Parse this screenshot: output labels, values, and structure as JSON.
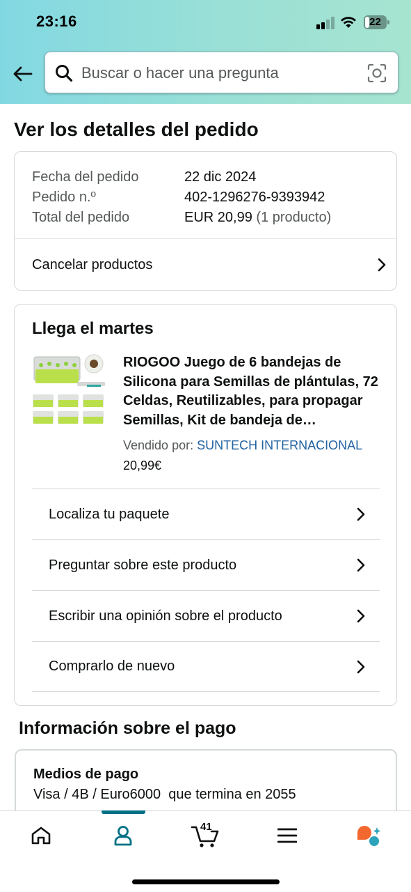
{
  "status_bar": {
    "time": "23:16",
    "battery": "22",
    "battery_level": 0.22
  },
  "header": {
    "back_icon": "arrow-left-icon",
    "search_placeholder": "Buscar o hacer una pregunta",
    "search_icon": "search-icon",
    "camera_icon": "camera-scan-icon"
  },
  "page": {
    "title": "Ver los detalles del pedido"
  },
  "order_summary": {
    "rows": [
      {
        "label": "Fecha del pedido",
        "value": "22 dic 2024",
        "extra": ""
      },
      {
        "label": "Pedido n.º",
        "value": "402-1296276-9393942",
        "extra": ""
      },
      {
        "label": "Total del pedido",
        "value": "EUR 20,99",
        "extra": "(1 producto)"
      }
    ],
    "cancel_label": "Cancelar productos"
  },
  "delivery": {
    "title": "Llega el martes",
    "product": {
      "title": "RIOGOO Juego de 6 bandejas de Silicona para Semillas de plántulas, 72 Celdas, Reutilizables, para propagar Semillas, Kit de bandeja de germinación",
      "seller_prefix": "Vendido por:",
      "seller_name": "SUNTECH INTERNACIONAL",
      "price": "20,99€"
    },
    "actions": [
      {
        "label": "Localiza tu paquete"
      },
      {
        "label": "Preguntar sobre este producto"
      },
      {
        "label": "Escribir una opinión sobre el producto"
      },
      {
        "label": "Comprarlo de nuevo"
      }
    ]
  },
  "payment": {
    "section_title": "Información sobre el pago",
    "method_label": "Medios de pago",
    "method_value": "Visa / 4B / Euro6000  que termina en 2055"
  },
  "bottom_nav": {
    "items": [
      "home-icon",
      "account-icon",
      "cart-icon",
      "menu-icon",
      "rufus-ai-icon"
    ],
    "active": "account-icon",
    "cart_count": "41"
  },
  "colors": {
    "header_gradient_start": "#82d8e2",
    "header_gradient_end": "#a6e4d0",
    "link": "#2162a1",
    "accent": "#007185",
    "rufus_orange": "#f3682e",
    "rufus_teal": "#2ba3b9"
  }
}
